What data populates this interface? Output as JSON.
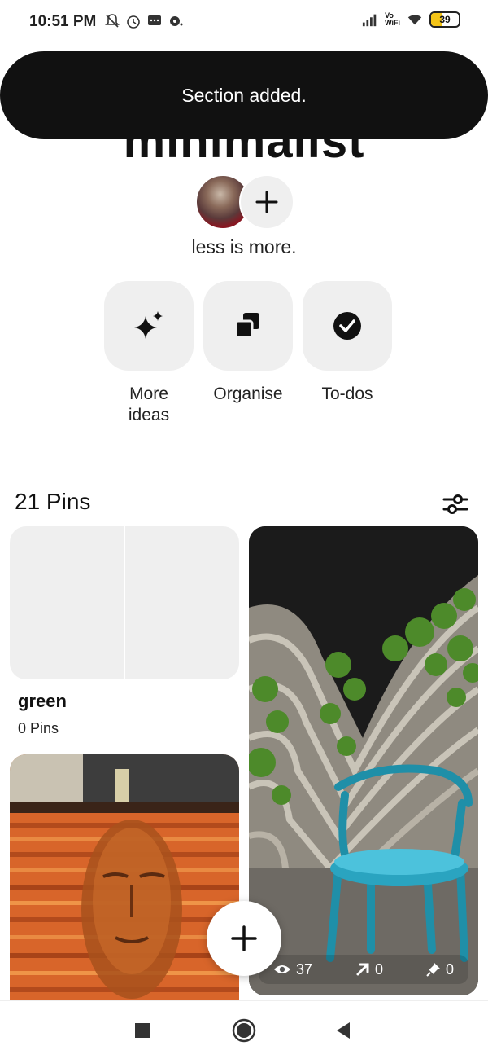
{
  "status_bar": {
    "time": "10:51 PM",
    "battery": "39",
    "battery_level": 0.39,
    "network_label_top": "Vo",
    "network_label_bottom": "WiFi",
    "icons": [
      "bell-off-icon",
      "alarm-icon",
      "message-icon",
      "notification-icon",
      "signal-icon",
      "wifi-icon",
      "battery-icon"
    ]
  },
  "toast": {
    "message": "Section added."
  },
  "board": {
    "title": "minimalist",
    "description": "less is more."
  },
  "actions": [
    {
      "label_line1": "More",
      "label_line2": "ideas",
      "icon": "sparkle-icon"
    },
    {
      "label_line1": "Organise",
      "label_line2": "",
      "icon": "organise-icon"
    },
    {
      "label_line1": "To-dos",
      "label_line2": "",
      "icon": "check-circle-icon"
    }
  ],
  "pins": {
    "count_label": "21 Pins",
    "section": {
      "name": "green",
      "count": "0 Pins"
    },
    "chair_pin_stats": {
      "views": "37",
      "outbound": "0",
      "saves": "0"
    }
  },
  "colors": {
    "toast_bg": "#111111",
    "tile_bg": "#efefef",
    "text": "#111111"
  }
}
